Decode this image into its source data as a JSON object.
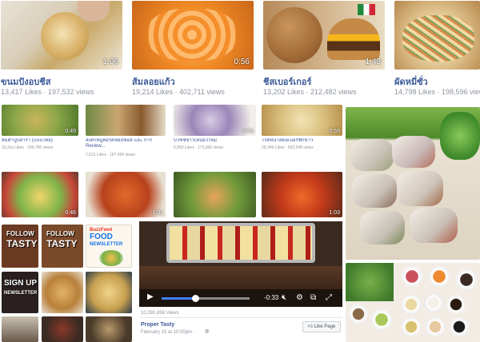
{
  "colors": {
    "link": "#3b5998",
    "meta": "#8d949e",
    "accent": "#4080ff"
  },
  "top_videos": [
    {
      "title": "ขนมปังอบชีส",
      "stats": "13,417 Likes · 197,532 views",
      "duration": "1:06"
    },
    {
      "title": "ส้มลอยแก้ว",
      "stats": "19,214 Likes · 402,711 views",
      "duration": "0:56"
    },
    {
      "title": "ชีสเบอร์เกอร์",
      "stats": "13,202 Likes · 212,482 views",
      "duration": "1:43"
    },
    {
      "title": "ผัดหมี่ซั่ว",
      "stats": "14,798 Likes · 198,596 views",
      "duration": ""
    }
  ],
  "small_videos": [
    {
      "title": "ส้มตำปูปลาร้า (แบบไทย)",
      "stats": "10,2xx Likes · 249,760 views",
      "duration": "0:49"
    },
    {
      "title": "สเต๊กหมูพอร์คชอปซอส และ การ Review...",
      "stats": "7,613 Likes · 197,494 views",
      "duration": ""
    },
    {
      "title": "บวชชีข้าวเหนียวใหม่",
      "stats": "6,950 Likes · 173,066 views",
      "duration": "0:56"
    },
    {
      "title": "โรตีหน้าสตอเบอรี่ฟักข้าว",
      "stats": "26,349 Likes · 692,548 views",
      "duration": "0:59"
    }
  ],
  "row_three_durations": [
    "0:46",
    "",
    "1:31",
    "1:03"
  ],
  "posters": {
    "follow_label": "FOLLOW",
    "tasty_label": "TASTY",
    "buzzfeed_label": "BuzzFeed",
    "food_label": "FOOD",
    "newsletter_label": "NEWSLETTER",
    "signup_label": "SIGN UP"
  },
  "player": {
    "progress": 0.38,
    "time_remaining": "-0:33",
    "views": "10,391,856 Views",
    "page_name": "Proper Tasty",
    "date": "February 15 at 10:00pm ·",
    "like_page_label": "Like Page"
  }
}
